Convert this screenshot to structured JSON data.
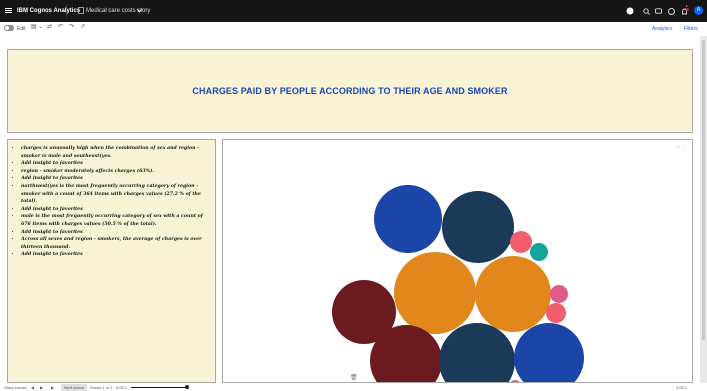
{
  "header": {
    "brand": "IBM Cognos Analytics",
    "document_title": "Medical care costs story",
    "notification_count": "1",
    "user_initial": "A"
  },
  "toolbar": {
    "edit_label": "Edit",
    "analytics_label": "Analytics",
    "filters_label": "Filters"
  },
  "dashboard": {
    "title": "CHARGES PAID BY PEOPLE ACCORDING TO THEIR AGE AND SMOKER",
    "insights": [
      "charges is unusually high when the combination of sex and region - smoker is male and southeast(yes.",
      "Add insight to favorites",
      "region - smoker moderately affects charges (63%).",
      "Add insight to favorites",
      "northwest(yes is the most frequently occurring category of region - smoker with a count of 364 items with charges values (27.2 % of the total).",
      "Add insight to favorites",
      "male is the most frequently occurring category of sex with a count of 676 items with charges values (50.5 % of the total).",
      "Add insight to favorites",
      "Across all sexes and region - smokers, the average of charges is over thirteen thousand.",
      "Add insight to favorites"
    ]
  },
  "chart_data": {
    "type": "packed-bubble",
    "bubbles": [
      {
        "color": "#1c45a8",
        "size": 34
      },
      {
        "color": "#1a3a58",
        "size": 36
      },
      {
        "color": "#f05d6c",
        "size": 11
      },
      {
        "color": "#12a59b",
        "size": 9
      },
      {
        "color": "#e2871c",
        "size": 41
      },
      {
        "color": "#e2871c",
        "size": 38
      },
      {
        "color": "#e05a8a",
        "size": 9
      },
      {
        "color": "#f05d6c",
        "size": 10
      },
      {
        "color": "#6b1a1f",
        "size": 32
      },
      {
        "color": "#6b1a1f",
        "size": 36
      },
      {
        "color": "#1a3a58",
        "size": 38
      },
      {
        "color": "#1c45a8",
        "size": 35
      },
      {
        "color": "#e05a8a",
        "size": 6
      }
    ]
  },
  "footer": {
    "items": [
      "Story scenes",
      "Next scene",
      "Scene 1 of 1",
      "0:00:1",
      "0:00:1"
    ]
  }
}
